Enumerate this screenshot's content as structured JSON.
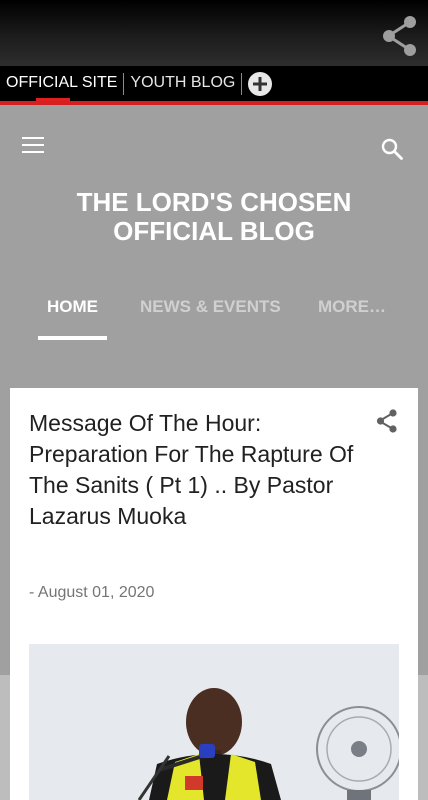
{
  "topbar": {
    "share_icon": "share-icon"
  },
  "tabs": [
    {
      "label": "OFFICIAL SITE",
      "active": true
    },
    {
      "label": "YOUTH BLOG",
      "active": false
    }
  ],
  "tabs_add_icon": "plus-circle-icon",
  "header": {
    "menu_icon": "hamburger-menu-icon",
    "search_icon": "search-icon",
    "title_line1": "THE LORD'S CHOSEN",
    "title_line2": "OFFICIAL BLOG"
  },
  "nav": [
    {
      "label": "HOME",
      "active": true
    },
    {
      "label": "NEWS & EVENTS",
      "active": false
    },
    {
      "label": "MORE…",
      "active": false
    }
  ],
  "post": {
    "title": "Message Of The Hour: Preparation For The Rapture Of The Sanits ( Pt 1) .. By Pastor Lazarus Muoka",
    "date": "- August 01, 2020",
    "share_icon": "share-icon"
  },
  "colors": {
    "accent_red": "#d42020",
    "header_gray": "#a0a0a0",
    "vest_yellow": "#e3e62a"
  }
}
